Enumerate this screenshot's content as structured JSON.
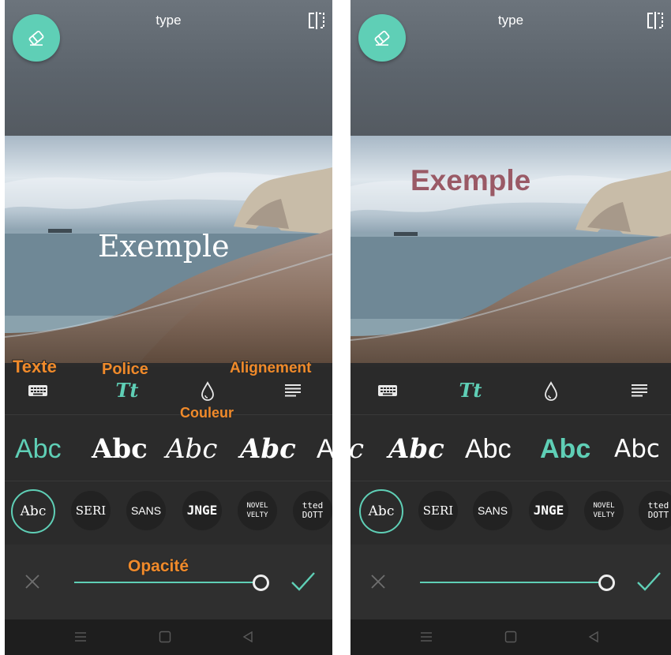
{
  "left_panel": {
    "app_title": "type",
    "overlay_text": "Exemple",
    "styles": [
      "Abc",
      "Abc",
      "Abc",
      "Abc",
      "A"
    ],
    "font_chips": [
      "Abc",
      "SERI",
      "SANS",
      "JNGE",
      "NOVEL VELTY",
      "tted DOTT"
    ],
    "annotations": {
      "text": "Texte",
      "font": "Police",
      "align": "Alignement",
      "color": "Couleur",
      "opacity": "Opacité"
    }
  },
  "right_panel": {
    "app_title": "type",
    "overlay_text": "Exemple",
    "styles": [
      "c",
      "Abc",
      "Abc",
      "Abc",
      "Abc"
    ],
    "font_chips": [
      "Abc",
      "SERI",
      "SANS",
      "JNGE",
      "NOVEL VELTY",
      "tted DOTT"
    ]
  },
  "toolbar": {
    "icons": [
      "keyboard-icon",
      "font-icon",
      "drop-icon",
      "align-icon"
    ],
    "font_glyph": "Tt"
  },
  "opacity": {
    "value": 0.96
  },
  "colors": {
    "accent": "#5fcfb6",
    "annotation": "#f08a2a",
    "right_overlay_text": "#9a5a66",
    "panel_bg": "#2b2b2b"
  },
  "nav_icons": [
    "menu-icon",
    "home-square-icon",
    "back-triangle-icon"
  ]
}
